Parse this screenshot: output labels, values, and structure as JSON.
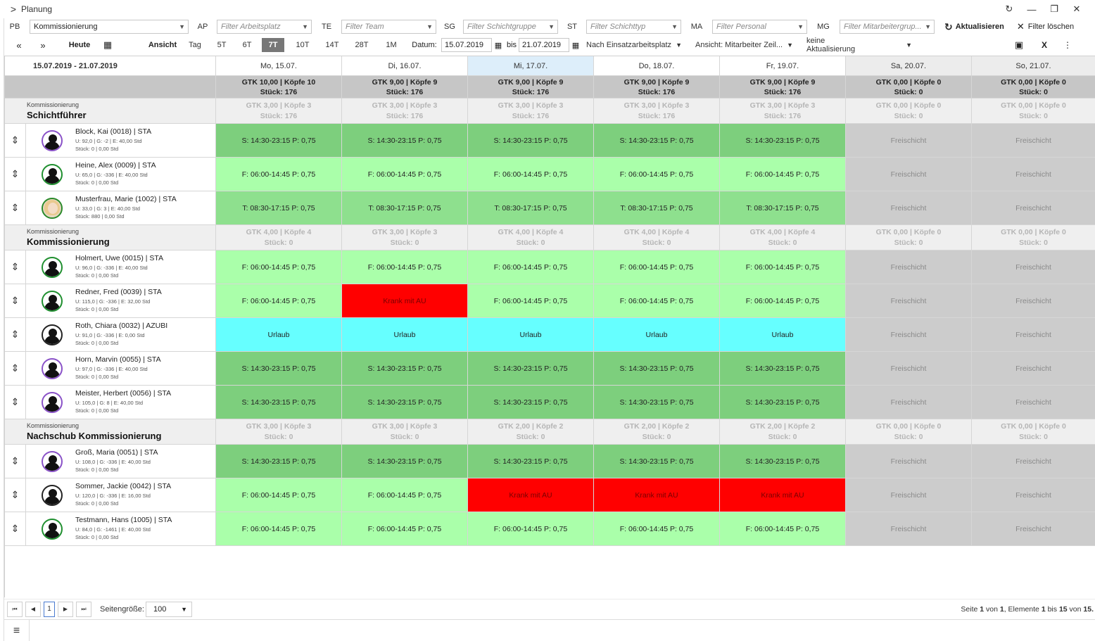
{
  "window": {
    "title": "Planung",
    "controls": [
      "↻",
      "—",
      "❐",
      "✕"
    ]
  },
  "filters": [
    {
      "label": "PB",
      "value": "Kommissionierung",
      "placeholder": ""
    },
    {
      "label": "AP",
      "value": "",
      "placeholder": "Filter Arbeitsplatz"
    },
    {
      "label": "TE",
      "value": "",
      "placeholder": "Filter Team"
    },
    {
      "label": "SG",
      "value": "",
      "placeholder": "Filter Schichtgruppe"
    },
    {
      "label": "ST",
      "value": "",
      "placeholder": "Filter Schichttyp"
    },
    {
      "label": "MA",
      "value": "",
      "placeholder": "Filter Personal"
    },
    {
      "label": "MG",
      "value": "",
      "placeholder": "Filter Mitarbeitergrup..."
    }
  ],
  "actions": {
    "refresh": "Aktualisieren",
    "clear": "Filter löschen"
  },
  "toolbar": {
    "prev": "«",
    "next": "»",
    "today": "Heute",
    "view_label": "Ansicht",
    "views": [
      "Tag",
      "5T",
      "6T",
      "7T",
      "10T",
      "14T",
      "28T",
      "1M"
    ],
    "active_view": "7T",
    "date_label": "Datum:",
    "date_from": "15.07.2019",
    "until": "bis",
    "date_to": "21.07.2019",
    "group_by": "Nach Einsatzarbeitsplatz",
    "view_mode": "Ansicht: Mitarbeiter Zeil...",
    "refresh_mode": "keine Aktualisierung"
  },
  "grid": {
    "range": "15.07.2019 - 21.07.2019",
    "days": [
      "Mo, 15.07.",
      "Di, 16.07.",
      "Mi, 17.07.",
      "Do, 18.07.",
      "Fr, 19.07.",
      "Sa, 20.07.",
      "So, 21.07."
    ],
    "today_index": 2,
    "weekend_index": [
      5,
      6
    ],
    "totals": [
      [
        "GTK 10,00 | Köpfe 10",
        "Stück: 176"
      ],
      [
        "GTK 9,00 | Köpfe 9",
        "Stück: 176"
      ],
      [
        "GTK 9,00 | Köpfe 9",
        "Stück: 176"
      ],
      [
        "GTK 9,00 | Köpfe 9",
        "Stück: 176"
      ],
      [
        "GTK 9,00 | Köpfe 9",
        "Stück: 176"
      ],
      [
        "GTK 0,00 | Köpfe 0",
        "Stück: 0"
      ],
      [
        "GTK 0,00 | Köpfe 0",
        "Stück: 0"
      ]
    ],
    "groups": [
      {
        "sub": "Kommissionierung",
        "name": "Schichtführer",
        "stats": [
          [
            "GTK 3,00 | Köpfe 3",
            "Stück: 176"
          ],
          [
            "GTK 3,00 | Köpfe 3",
            "Stück: 176"
          ],
          [
            "GTK 3,00 | Köpfe 3",
            "Stück: 176"
          ],
          [
            "GTK 3,00 | Köpfe 3",
            "Stück: 176"
          ],
          [
            "GTK 3,00 | Köpfe 3",
            "Stück: 176"
          ],
          [
            "GTK 0,00 | Köpfe 0",
            "Stück: 0"
          ],
          [
            "GTK 0,00 | Köpfe 0",
            "Stück: 0"
          ]
        ],
        "employees": [
          {
            "name": "Block, Kai (0018) | STA",
            "meta1": "U: 92,0 | G: -2 | E: 40,00 Std",
            "meta2": "Stück: 0 | 0,00 Std",
            "avatar": "purple",
            "shifts": [
              [
                "S: 14:30-23:15 P: 0,75",
                "s-dark"
              ],
              [
                "S: 14:30-23:15 P: 0,75",
                "s-dark"
              ],
              [
                "S: 14:30-23:15 P: 0,75",
                "s-dark"
              ],
              [
                "S: 14:30-23:15 P: 0,75",
                "s-dark"
              ],
              [
                "S: 14:30-23:15 P: 0,75",
                "s-dark"
              ],
              [
                "Freischicht",
                "s-free"
              ],
              [
                "Freischicht",
                "s-free"
              ]
            ]
          },
          {
            "name": "Heine, Alex (0009) | STA",
            "meta1": "U: 65,0 | G: -336 | E: 40,00 Std",
            "meta2": "Stück: 0 | 0,00 Std",
            "avatar": "green",
            "shifts": [
              [
                "F: 06:00-14:45 P: 0,75",
                "s-light"
              ],
              [
                "F: 06:00-14:45 P: 0,75",
                "s-light"
              ],
              [
                "F: 06:00-14:45 P: 0,75",
                "s-light"
              ],
              [
                "F: 06:00-14:45 P: 0,75",
                "s-light"
              ],
              [
                "F: 06:00-14:45 P: 0,75",
                "s-light"
              ],
              [
                "Freischicht",
                "s-free"
              ],
              [
                "Freischicht",
                "s-free"
              ]
            ]
          },
          {
            "name": "Musterfrau, Marie (1002) | STA",
            "meta1": "U: 33,0 | G: 3 | E: 40,00 Std",
            "meta2": "Stück: 880 | 0,00 Std",
            "avatar": "photo",
            "shifts": [
              [
                "T: 08:30-17:15 P: 0,75",
                "s-mid"
              ],
              [
                "T: 08:30-17:15 P: 0,75",
                "s-mid"
              ],
              [
                "T: 08:30-17:15 P: 0,75",
                "s-mid"
              ],
              [
                "T: 08:30-17:15 P: 0,75",
                "s-mid"
              ],
              [
                "T: 08:30-17:15 P: 0,75",
                "s-mid"
              ],
              [
                "Freischicht",
                "s-free"
              ],
              [
                "Freischicht",
                "s-free"
              ]
            ]
          }
        ]
      },
      {
        "sub": "Kommissionierung",
        "name": "Kommissionierung",
        "stats": [
          [
            "GTK 4,00 | Köpfe 4",
            "Stück: 0"
          ],
          [
            "GTK 3,00 | Köpfe 3",
            "Stück: 0"
          ],
          [
            "GTK 4,00 | Köpfe 4",
            "Stück: 0"
          ],
          [
            "GTK 4,00 | Köpfe 4",
            "Stück: 0"
          ],
          [
            "GTK 4,00 | Köpfe 4",
            "Stück: 0"
          ],
          [
            "GTK 0,00 | Köpfe 0",
            "Stück: 0"
          ],
          [
            "GTK 0,00 | Köpfe 0",
            "Stück: 0"
          ]
        ],
        "employees": [
          {
            "name": "Holmert, Uwe (0015) | STA",
            "meta1": "U: 96,0 | G: -336 | E: 40,00 Std",
            "meta2": "Stück: 0 | 0,00 Std",
            "avatar": "green",
            "shifts": [
              [
                "F: 06:00-14:45 P: 0,75",
                "s-light"
              ],
              [
                "F: 06:00-14:45 P: 0,75",
                "s-light"
              ],
              [
                "F: 06:00-14:45 P: 0,75",
                "s-light"
              ],
              [
                "F: 06:00-14:45 P: 0,75",
                "s-light"
              ],
              [
                "F: 06:00-14:45 P: 0,75",
                "s-light"
              ],
              [
                "Freischicht",
                "s-free"
              ],
              [
                "Freischicht",
                "s-free"
              ]
            ]
          },
          {
            "name": "Redner, Fred (0039) | STA",
            "meta1": "U: 115,0 | G: -336 | E: 32,00 Std",
            "meta2": "Stück: 0 | 0,00 Std",
            "avatar": "green",
            "shifts": [
              [
                "F: 06:00-14:45 P: 0,75",
                "s-light"
              ],
              [
                "Krank mit AU",
                "s-red"
              ],
              [
                "F: 06:00-14:45 P: 0,75",
                "s-light"
              ],
              [
                "F: 06:00-14:45 P: 0,75",
                "s-light"
              ],
              [
                "F: 06:00-14:45 P: 0,75",
                "s-light"
              ],
              [
                "Freischicht",
                "s-free"
              ],
              [
                "Freischicht",
                "s-free"
              ]
            ]
          },
          {
            "name": "Roth, Chiara (0032) | AZUBI",
            "meta1": "U: 91,0 | G: -336 | E: 0,00 Std",
            "meta2": "Stück: 0 | 0,00 Std",
            "avatar": "black",
            "shifts": [
              [
                "Urlaub",
                "s-cyan"
              ],
              [
                "Urlaub",
                "s-cyan"
              ],
              [
                "Urlaub",
                "s-cyan"
              ],
              [
                "Urlaub",
                "s-cyan"
              ],
              [
                "Urlaub",
                "s-cyan"
              ],
              [
                "Freischicht",
                "s-free"
              ],
              [
                "Freischicht",
                "s-free"
              ]
            ]
          },
          {
            "name": "Horn, Marvin (0055) | STA",
            "meta1": "U: 97,0 | G: -336 | E: 40,00 Std",
            "meta2": "Stück: 0 | 0,00 Std",
            "avatar": "purple",
            "shifts": [
              [
                "S: 14:30-23:15 P: 0,75",
                "s-dark"
              ],
              [
                "S: 14:30-23:15 P: 0,75",
                "s-dark"
              ],
              [
                "S: 14:30-23:15 P: 0,75",
                "s-dark"
              ],
              [
                "S: 14:30-23:15 P: 0,75",
                "s-dark"
              ],
              [
                "S: 14:30-23:15 P: 0,75",
                "s-dark"
              ],
              [
                "Freischicht",
                "s-free"
              ],
              [
                "Freischicht",
                "s-free"
              ]
            ]
          },
          {
            "name": "Meister, Herbert (0056) | STA",
            "meta1": "U: 105,0 | G: 8 | E: 40,00 Std",
            "meta2": "Stück: 0 | 0,00 Std",
            "avatar": "purple",
            "shifts": [
              [
                "S: 14:30-23:15 P: 0,75",
                "s-dark"
              ],
              [
                "S: 14:30-23:15 P: 0,75",
                "s-dark"
              ],
              [
                "S: 14:30-23:15 P: 0,75",
                "s-dark"
              ],
              [
                "S: 14:30-23:15 P: 0,75",
                "s-dark"
              ],
              [
                "S: 14:30-23:15 P: 0,75",
                "s-dark"
              ],
              [
                "Freischicht",
                "s-free"
              ],
              [
                "Freischicht",
                "s-free"
              ]
            ]
          }
        ]
      },
      {
        "sub": "Kommissionierung",
        "name": "Nachschub Kommissionierung",
        "stats": [
          [
            "GTK 3,00 | Köpfe 3",
            "Stück: 0"
          ],
          [
            "GTK 3,00 | Köpfe 3",
            "Stück: 0"
          ],
          [
            "GTK 2,00 | Köpfe 2",
            "Stück: 0"
          ],
          [
            "GTK 2,00 | Köpfe 2",
            "Stück: 0"
          ],
          [
            "GTK 2,00 | Köpfe 2",
            "Stück: 0"
          ],
          [
            "GTK 0,00 | Köpfe 0",
            "Stück: 0"
          ],
          [
            "GTK 0,00 | Köpfe 0",
            "Stück: 0"
          ]
        ],
        "employees": [
          {
            "name": "Groß, Maria (0051) | STA",
            "meta1": "U: 108,0 | G: -336 | E: 40,00 Std",
            "meta2": "Stück: 0 | 0,00 Std",
            "avatar": "purple",
            "shifts": [
              [
                "S: 14:30-23:15 P: 0,75",
                "s-dark"
              ],
              [
                "S: 14:30-23:15 P: 0,75",
                "s-dark"
              ],
              [
                "S: 14:30-23:15 P: 0,75",
                "s-dark"
              ],
              [
                "S: 14:30-23:15 P: 0,75",
                "s-dark"
              ],
              [
                "S: 14:30-23:15 P: 0,75",
                "s-dark"
              ],
              [
                "Freischicht",
                "s-free"
              ],
              [
                "Freischicht",
                "s-free"
              ]
            ]
          },
          {
            "name": "Sommer, Jackie (0042) | STA",
            "meta1": "U: 120,0 | G: -336 | E: 16,00 Std",
            "meta2": "Stück: 0 | 0,00 Std",
            "avatar": "black",
            "shifts": [
              [
                "F: 06:00-14:45 P: 0,75",
                "s-light"
              ],
              [
                "F: 06:00-14:45 P: 0,75",
                "s-light"
              ],
              [
                "Krank mit AU",
                "s-red"
              ],
              [
                "Krank mit AU",
                "s-red"
              ],
              [
                "Krank mit AU",
                "s-red"
              ],
              [
                "Freischicht",
                "s-free"
              ],
              [
                "Freischicht",
                "s-free"
              ]
            ]
          },
          {
            "name": "Testmann, Hans (1005) | STA",
            "meta1": "U: 84,0 | G: -1461 | E: 40,00 Std",
            "meta2": "Stück: 0 | 0,00 Std",
            "avatar": "green",
            "shifts": [
              [
                "F: 06:00-14:45 P: 0,75",
                "s-light"
              ],
              [
                "F: 06:00-14:45 P: 0,75",
                "s-light"
              ],
              [
                "F: 06:00-14:45 P: 0,75",
                "s-light"
              ],
              [
                "F: 06:00-14:45 P: 0,75",
                "s-light"
              ],
              [
                "F: 06:00-14:45 P: 0,75",
                "s-light"
              ],
              [
                "Freischicht",
                "s-free"
              ],
              [
                "Freischicht",
                "s-free"
              ]
            ]
          }
        ]
      }
    ]
  },
  "pager": {
    "first": "⏮",
    "prev": "◀",
    "page": "1",
    "next": "▶",
    "last": "⏭",
    "size_label": "Seitengröße:",
    "size": "100",
    "info_pre": "Seite ",
    "info_page": "1",
    "info_mid1": " von ",
    "info_pages": "1",
    "info_mid2": ", Elemente ",
    "info_from": "1",
    "info_mid3": " bis ",
    "info_to": "15",
    "info_mid4": " von ",
    "info_total": "15."
  },
  "footer": {
    "menu_icon": "≡"
  }
}
